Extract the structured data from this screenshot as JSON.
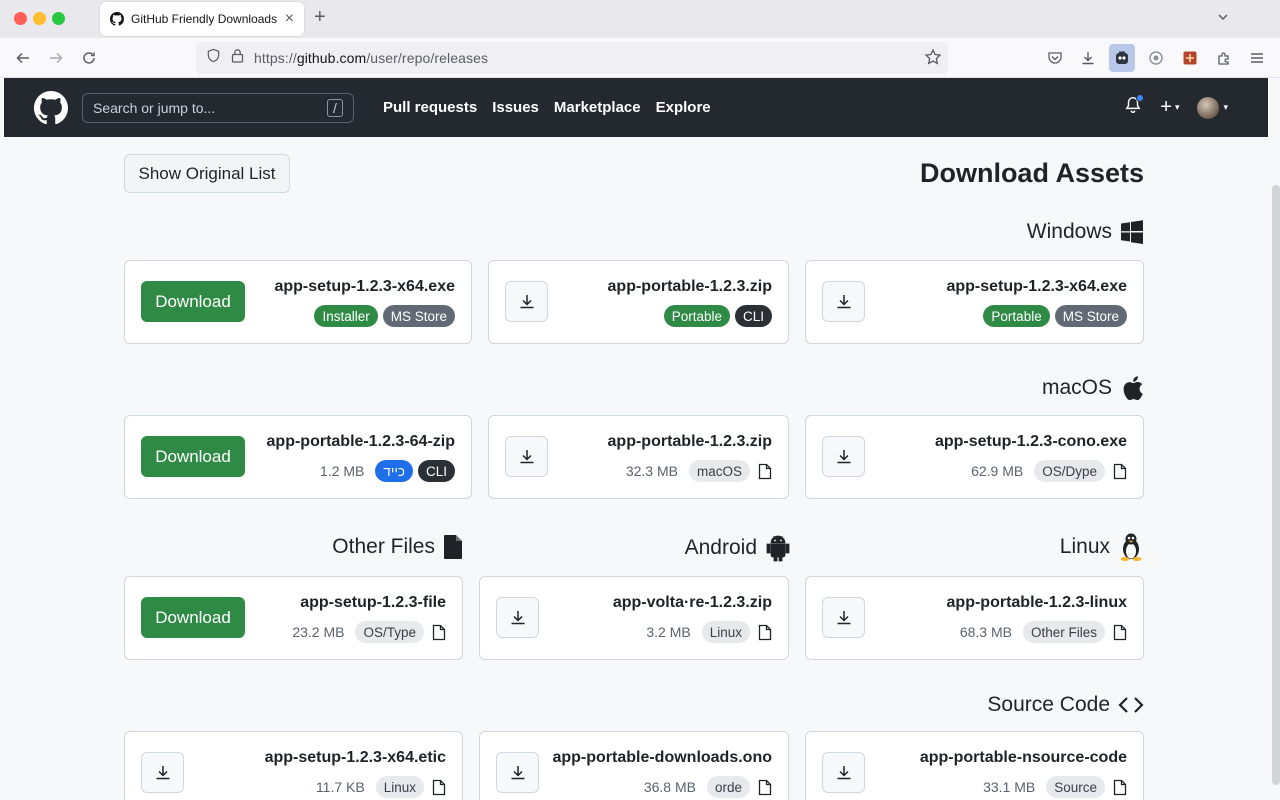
{
  "browser": {
    "tab_title": "GitHub Friendly Downloads",
    "url_prefix": "https://",
    "url_host": "github.com",
    "url_path": "/user/repo/releases"
  },
  "header": {
    "search_placeholder": "Search or jump to...",
    "slash_key": "/",
    "nav": [
      "Pull requests",
      "Issues",
      "Marketplace",
      "Explore"
    ]
  },
  "main": {
    "show_original_label": "Show Original List",
    "title": "Download Assets",
    "download_label": "Download",
    "sections": [
      {
        "name": "Windows",
        "icon": "windows-icon"
      },
      {
        "name": "macOS",
        "icon": "apple-icon"
      },
      {
        "name": "Other Files",
        "icon": "file-icon"
      },
      {
        "name": "Android",
        "icon": "android-icon"
      },
      {
        "name": "Linux",
        "icon": "linux-icon"
      },
      {
        "name": "Source Code",
        "icon": "code-icon"
      }
    ],
    "assets": [
      {
        "name": "app-setup-1.2.3-x64.exe",
        "tags": [
          "Installer",
          "MS Store"
        ]
      },
      {
        "name": "app-portable-1.2.3.zip",
        "tags": [
          "Portable",
          "CLI"
        ]
      },
      {
        "name": "app-setup-1.2.3-x64.exe",
        "tags": [
          "Portable",
          "MS Store"
        ]
      },
      {
        "name": "app-portable-1.2.3-64-zip",
        "size": "1.2 MB",
        "tags": [
          "כייד",
          "CLI"
        ]
      },
      {
        "name": "app-portable-1.2.3.zip",
        "size": "32.3 MB",
        "tags": [
          "macOS"
        ]
      },
      {
        "name": "app-setup-1.2.3-cono.exe",
        "size": "62.9 MB",
        "tags": [
          "OS/Dype"
        ]
      },
      {
        "name": "app-setup-1.2.3-file",
        "size": "23.2 MB",
        "tags": [
          "OS/Type"
        ]
      },
      {
        "name": "app-volta·re-1.2.3.zip",
        "size": "3.2 MB",
        "tags": [
          "Linux"
        ]
      },
      {
        "name": "app-portable-1.2.3-linux",
        "size": "68.3 MB",
        "tags": [
          "Other Files"
        ]
      },
      {
        "name": "app-setup-1.2.3-x64.etic",
        "size": "11.7 KB",
        "tags": [
          "Linux"
        ]
      },
      {
        "name": "app-portable-downloads.ono",
        "size": "36.8 MB",
        "tags": [
          "orde"
        ]
      },
      {
        "name": "app-portable-nsource-code",
        "size": "33.1 MB",
        "tags": [
          "Source"
        ]
      }
    ]
  },
  "colors": {
    "header_bg": "#24292f",
    "download_green": "#2f8a46",
    "tag_gray": "#616a74",
    "tag_blue": "#1f6feb"
  }
}
